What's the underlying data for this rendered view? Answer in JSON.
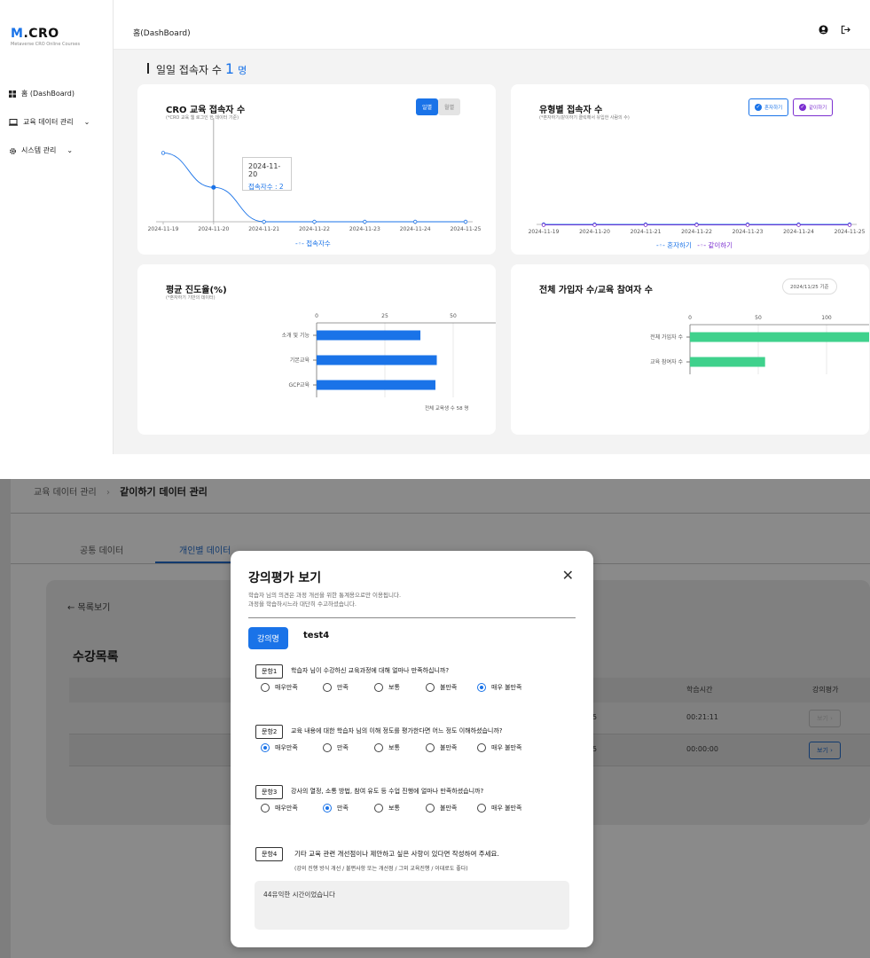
{
  "app": {
    "brand_m": "M",
    "brand_rest": ".CRO",
    "brand_sub": "Metaverse CRO Online Courses"
  },
  "sidebar": {
    "items": [
      {
        "label": "홈 (DashBoard)"
      },
      {
        "label": "교육 데이터 관리"
      },
      {
        "label": "시스템 관리"
      }
    ]
  },
  "header": {
    "title": "홈(DashBoard)"
  },
  "daily": {
    "label": "일일 접속자 수",
    "value": "1",
    "unit": "명"
  },
  "cro_card": {
    "title": "CRO 교육 접속자 수",
    "subtitle": "(*CRO 교육 웹 로그인 한 데이터 기준)",
    "toggle": [
      "일별",
      "월별"
    ],
    "tooltip_date": "2024-11-20",
    "tooltip_value": "접속자수 : 2",
    "legend": "접속자수"
  },
  "type_card": {
    "title": "유형별 접속자 수",
    "subtitle": "(*혼자하기/같이하기 클릭해서 유입한 사람의 수)",
    "chips": [
      "혼자하기",
      "같이하기"
    ],
    "legend": [
      "혼자하기",
      "같이하기"
    ]
  },
  "progress_card": {
    "title": "평균 진도율(%)",
    "subtitle": "(*혼자하기 기반의 데이터)",
    "footnote": "전체 교육생 수 58 명"
  },
  "members_card": {
    "title": "전체 가입자 수/교육 참여자 수",
    "badge": "2024/11/25 기준"
  },
  "chart_data": [
    {
      "type": "line",
      "title": "CRO 교육 접속자 수",
      "x": [
        "2024-11-19",
        "2024-11-20",
        "2024-11-21",
        "2024-11-22",
        "2024-11-23",
        "2024-11-24",
        "2024-11-25"
      ],
      "series": [
        {
          "name": "접속자수",
          "values": [
            4,
            2,
            0,
            0,
            0,
            0,
            0
          ]
        }
      ],
      "ylim": [
        0,
        5
      ],
      "color": "#1a73e8"
    },
    {
      "type": "line",
      "title": "유형별 접속자 수",
      "x": [
        "2024-11-19",
        "2024-11-20",
        "2024-11-21",
        "2024-11-22",
        "2024-11-23",
        "2024-11-24",
        "2024-11-25"
      ],
      "series": [
        {
          "name": "혼자하기",
          "values": [
            0,
            0,
            0,
            0,
            0,
            0,
            0
          ],
          "color": "#1a73e8"
        },
        {
          "name": "같이하기",
          "values": [
            0,
            0,
            0,
            0,
            0,
            0,
            0
          ],
          "color": "#7b2fd0"
        }
      ]
    },
    {
      "type": "bar",
      "orientation": "horizontal",
      "title": "평균 진도율(%)",
      "categories": [
        "소개 및 기능",
        "기본교육",
        "GCP교육"
      ],
      "values": [
        38,
        44,
        43.5
      ],
      "xlim": [
        0,
        100
      ],
      "ticks": [
        0,
        25,
        50,
        75,
        100
      ],
      "color": "#1a73e8"
    },
    {
      "type": "bar",
      "orientation": "horizontal",
      "title": "전체 가입자 수/교육 참여자 수",
      "categories": [
        "전체 가입자 수",
        "교육 참여자 수"
      ],
      "values": [
        170,
        55
      ],
      "xlim": [
        0,
        200
      ],
      "ticks": [
        0,
        50,
        100,
        150,
        200
      ],
      "color": "#3fd18c"
    }
  ],
  "lower": {
    "breadcrumb_parent": "교육 데이터 관리",
    "breadcrumb_sep": "›",
    "breadcrumb_current": "같이하기 데이터 관리",
    "tabs": [
      "공통 데이터",
      "개인별 데이터"
    ],
    "back_label": "← 목록보기",
    "list_title": "수강목록",
    "col_time": "학습시간",
    "col_eval": "강의평가",
    "rows": [
      {
        "num": "5",
        "time": "00:21:11",
        "btn": "보기 ›"
      },
      {
        "num": "5",
        "time": "00:00:00",
        "btn": "보기 ›"
      }
    ]
  },
  "modal": {
    "title": "강의평가 보기",
    "close": "✕",
    "desc1": "학습자 님의 의견은 과정 개선을 위한 통계용으로만 이용됩니다.",
    "desc2": "과정을 학습하시느라 대단히 수고하셨습니다.",
    "course_label": "강의명",
    "course_name": "test4",
    "options": [
      "매우만족",
      "만족",
      "보통",
      "불만족",
      "매우 불만족"
    ],
    "questions": [
      {
        "tag": "문항1",
        "text": "학습자 님이 수강하신 교육과정에 대해 얼마나 만족하십니까?",
        "selected": 4
      },
      {
        "tag": "문항2",
        "text": "교육 내용에 대한 학습자 님의 이해 정도를 평가한다면 어느 정도 이해하셨습니까?",
        "selected": 0
      },
      {
        "tag": "문항3",
        "text": "강사의 열정, 소통 방법, 참여 유도 등 수업 진행에 얼마나 만족하셨습니까?",
        "selected": 1
      }
    ],
    "q4_tag": "문항4",
    "q4_text": "기타 교육 관련 개선점이나 제안하고 싶은 사항이 있다면 작성하여 주세요.",
    "q4_hint": "(강의 진행 방식 개선 / 불편사항 또는 개선점 / 그외 교육진행 / 이대로도 좋다)",
    "q4_answer": "44유익한 시간이었습니다"
  }
}
